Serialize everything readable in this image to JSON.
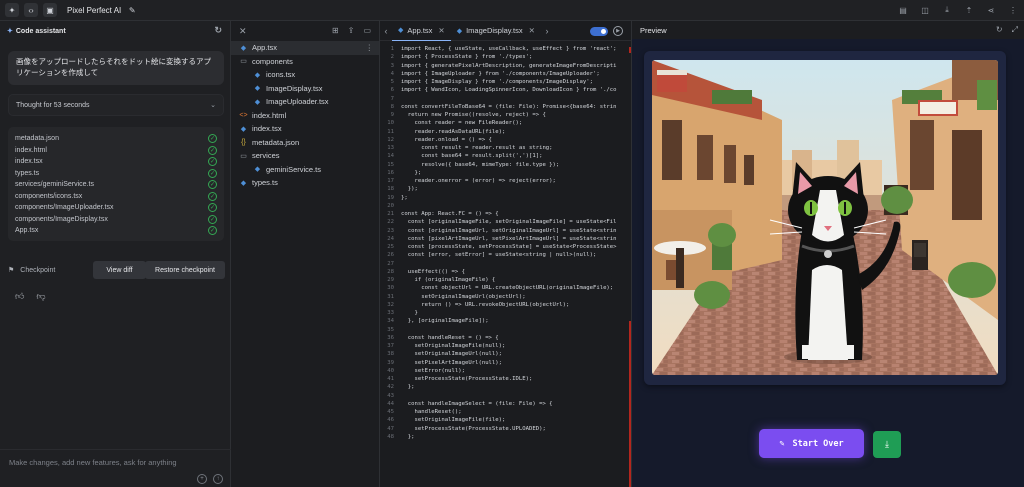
{
  "topbar": {
    "title": "Pixel Perfect AI"
  },
  "assistant": {
    "header": "Code assistant",
    "prompt": "画像をアップロードしたらそれをドット絵に変換するアプリケーションを作成して",
    "thought": "Thought for 53 seconds",
    "files": [
      "metadata.json",
      "index.html",
      "index.tsx",
      "types.ts",
      "services/geminiService.ts",
      "components/icons.tsx",
      "components/ImageUploader.tsx",
      "components/ImageDisplay.tsx",
      "App.tsx"
    ],
    "checkpoint": "Checkpoint",
    "view_diff": "View diff",
    "restore": "Restore checkpoint",
    "input_placeholder": "Make changes, add new features, ask for anything"
  },
  "explorer": {
    "tree": [
      {
        "label": "App.tsx",
        "type": "ts",
        "indent": 0,
        "selected": true
      },
      {
        "label": "components",
        "type": "folder",
        "indent": 0
      },
      {
        "label": "icons.tsx",
        "type": "ts",
        "indent": 1
      },
      {
        "label": "ImageDisplay.tsx",
        "type": "ts",
        "indent": 1
      },
      {
        "label": "ImageUploader.tsx",
        "type": "ts",
        "indent": 1
      },
      {
        "label": "index.html",
        "type": "html",
        "indent": 0
      },
      {
        "label": "index.tsx",
        "type": "ts",
        "indent": 0
      },
      {
        "label": "metadata.json",
        "type": "json",
        "indent": 0
      },
      {
        "label": "services",
        "type": "folder",
        "indent": 0
      },
      {
        "label": "geminiService.ts",
        "type": "ts",
        "indent": 1
      },
      {
        "label": "types.ts",
        "type": "ts",
        "indent": 0
      }
    ]
  },
  "editor": {
    "tabs": [
      "App.tsx",
      "ImageDisplay.tsx"
    ],
    "lines": [
      "import React, { useState, useCallback, useEffect } from 'react';",
      "import { ProcessState } from './types';",
      "import { generatePixelArtDescription, generateImageFromDescripti",
      "import { ImageUploader } from './components/ImageUploader';",
      "import { ImageDisplay } from './components/ImageDisplay';",
      "import { WandIcon, LoadingSpinnerIcon, DownloadIcon } from './co",
      "",
      "const convertFileToBase64 = (file: File): Promise<{base64: strin",
      "  return new Promise((resolve, reject) => {",
      "    const reader = new FileReader();",
      "    reader.readAsDataURL(file);",
      "    reader.onload = () => {",
      "      const result = reader.result as string;",
      "      const base64 = result.split(',')[1];",
      "      resolve({ base64, mimeType: file.type });",
      "    };",
      "    reader.onerror = (error) => reject(error);",
      "  });",
      "};",
      "",
      "const App: React.FC = () => {",
      "  const [originalImageFile, setOriginalImageFile] = useState<Fil",
      "  const [originalImageUrl, setOriginalImageUrl] = useState<strin",
      "  const [pixelArtImageUrl, setPixelArtImageUrl] = useState<strin",
      "  const [processState, setProcessState] = useState<ProcessState>",
      "  const [error, setError] = useState<string | null>(null);",
      "",
      "  useEffect(() => {",
      "    if (originalImageFile) {",
      "      const objectUrl = URL.createObjectURL(originalImageFile);",
      "      setOriginalImageUrl(objectUrl);",
      "      return () => URL.revokeObjectURL(objectUrl);",
      "    }",
      "  }, [originalImageFile]);",
      "",
      "  const handleReset = () => {",
      "    setOriginalImageFile(null);",
      "    setOriginalImageUrl(null);",
      "    setPixelArtImageUrl(null);",
      "    setError(null);",
      "    setProcessState(ProcessState.IDLE);",
      "  };",
      "",
      "  const handleImageSelect = (file: File) => {",
      "    handleReset();",
      "    setOriginalImageFile(file);",
      "    setProcessState(ProcessState.UPLOADED);",
      "  };"
    ]
  },
  "preview": {
    "title": "Preview",
    "start_over": "Start Over"
  }
}
